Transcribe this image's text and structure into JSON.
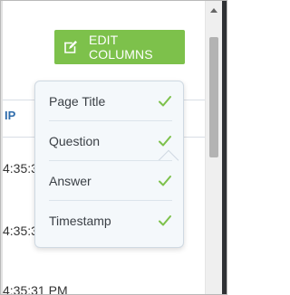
{
  "table": {
    "header_partial": "IP",
    "rows": [
      {
        "time_partial": "4:35:31"
      },
      {
        "time_partial": "4:35:31"
      },
      {
        "time_partial": "4:35:31 PM"
      }
    ]
  },
  "toolbar": {
    "edit_columns_label": "EDIT COLUMNS",
    "edit_icon": "edit-icon"
  },
  "column_menu": {
    "items": [
      {
        "label": "Page Title",
        "checked": true
      },
      {
        "label": "Question",
        "checked": true
      },
      {
        "label": "Answer",
        "checked": true
      },
      {
        "label": "Timestamp",
        "checked": true
      }
    ]
  },
  "colors": {
    "button": "#7dc14b",
    "check": "#7dc14b",
    "header_text": "#2f6cab",
    "popover_background": "#f4f8fb"
  }
}
